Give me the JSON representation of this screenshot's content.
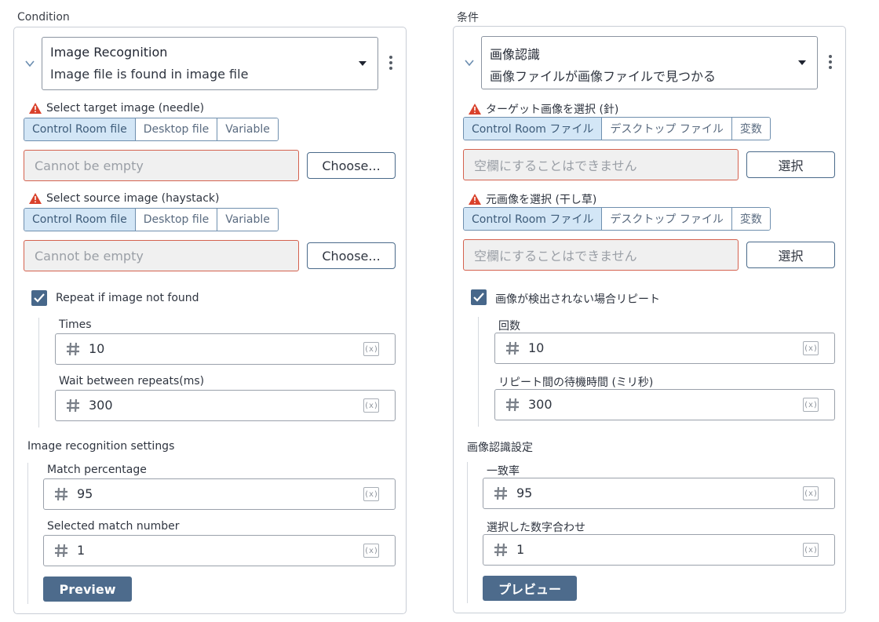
{
  "left": {
    "section_title": "Condition",
    "dropdown_title": "Image Recognition",
    "dropdown_subtitle": "Image file is found in image file",
    "needle_label": "Select target image (needle)",
    "needle_tabs": [
      "Control Room file",
      "Desktop file",
      "Variable"
    ],
    "needle_placeholder": "Cannot be empty",
    "choose_label": "Choose...",
    "haystack_label": "Select source image (haystack)",
    "haystack_tabs": [
      "Control Room file",
      "Desktop file",
      "Variable"
    ],
    "haystack_placeholder": "Cannot be empty",
    "repeat_label": "Repeat if image not found",
    "times_label": "Times",
    "times_value": "10",
    "wait_label": "Wait between repeats(ms)",
    "wait_value": "300",
    "settings_title": "Image recognition settings",
    "match_label": "Match percentage",
    "match_value": "95",
    "selected_label": "Selected match number",
    "selected_value": "1",
    "preview_label": "Preview",
    "var_icon": "(x)"
  },
  "right": {
    "section_title": "条件",
    "dropdown_title": "画像認識",
    "dropdown_subtitle": "画像ファイルが画像ファイルで見つかる",
    "needle_label": "ターゲット画像を選択 (針)",
    "needle_tabs": [
      "Control Room ファイル",
      "デスクトップ ファイル",
      "変数"
    ],
    "needle_placeholder": "空欄にすることはできません",
    "choose_label": "選択",
    "haystack_label": "元画像を選択 (干し草)",
    "haystack_tabs": [
      "Control Room ファイル",
      "デスクトップ ファイル",
      "変数"
    ],
    "haystack_placeholder": "空欄にすることはできません",
    "repeat_label": "画像が検出されない場合リピート",
    "times_label": "回数",
    "times_value": "10",
    "wait_label": "リピート間の待機時間 (ミリ秒)",
    "wait_value": "300",
    "settings_title": "画像認識設定",
    "match_label": "一致率",
    "match_value": "95",
    "selected_label": "選択した数字合わせ",
    "selected_value": "1",
    "preview_label": "プレビュー",
    "var_icon": "(x)"
  },
  "colors": {
    "error_border": "#d4624f",
    "accent": "#47678a",
    "active_tab": "#d3e6f6",
    "warning": "#d9412b"
  }
}
